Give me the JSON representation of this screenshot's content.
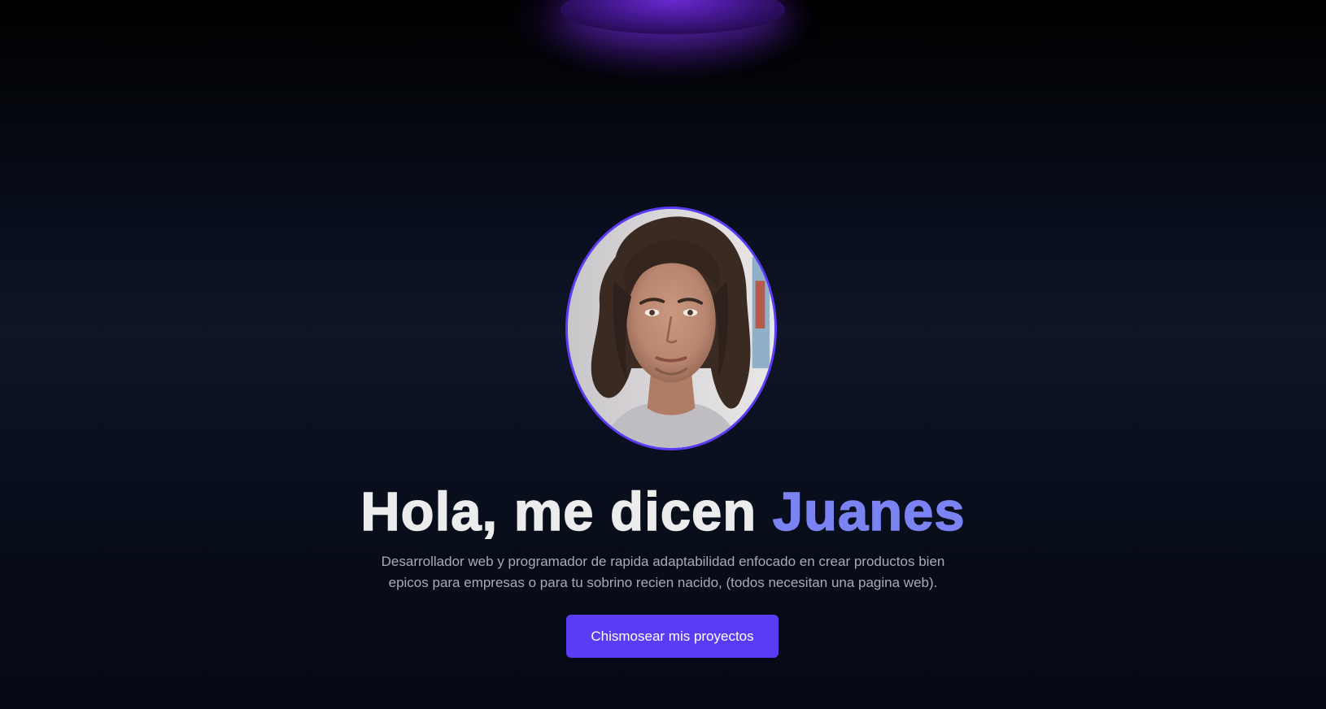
{
  "hero": {
    "headline_prefix": "Hola, me dicen ",
    "headline_name": "Juanes",
    "subtitle_line1": "Desarrollador web y programador de rapida adaptabilidad enfocado en crear productos bien",
    "subtitle_line2": "epicos para empresas o para tu sobrino recien nacido, (todos necesitan una pagina web).",
    "cta_label": "Chismosear mis proyectos"
  },
  "colors": {
    "accent": "#5a3cf5",
    "name_highlight": "#7b83f3",
    "glow": "#6a2ad0",
    "background": "#0a1020"
  },
  "avatar": {
    "icon": "profile-photo"
  }
}
